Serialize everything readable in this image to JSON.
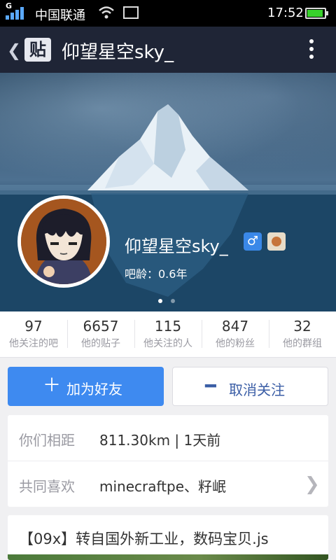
{
  "status_bar": {
    "network_badge": "G",
    "carrier": "中国联通",
    "time": "17:52",
    "battery_level": 0.85,
    "icons": [
      "signal-icon",
      "wifi-icon",
      "image-icon",
      "battery-icon"
    ]
  },
  "header": {
    "badge": "贴",
    "title": "仰望星空sky_"
  },
  "profile": {
    "name": "仰望星空sky_",
    "gender_symbol": "♂",
    "age_text": "吧龄：0.6年"
  },
  "stats": [
    {
      "value": "97",
      "label": "他关注的吧"
    },
    {
      "value": "6657",
      "label": "他的贴子"
    },
    {
      "value": "115",
      "label": "他关注的人"
    },
    {
      "value": "847",
      "label": "他的粉丝"
    },
    {
      "value": "32",
      "label": "他的群组"
    }
  ],
  "actions": {
    "add_friend_icon": "＋",
    "add_friend": "加为好友",
    "unfollow_icon": "━",
    "unfollow": "取消关注"
  },
  "info": {
    "distance_label": "你们相距",
    "distance_value": "811.30km | 1天前",
    "interests_label": "共同喜欢",
    "interests_value": "minecraftpe、籽岷"
  },
  "post": {
    "title": "【09x】转自国外新工业，数码宝贝.js"
  },
  "colors": {
    "header_bg": "#1f2536",
    "accent_blue": "#3e8af0",
    "unfollow_text": "#3b5ea6"
  }
}
